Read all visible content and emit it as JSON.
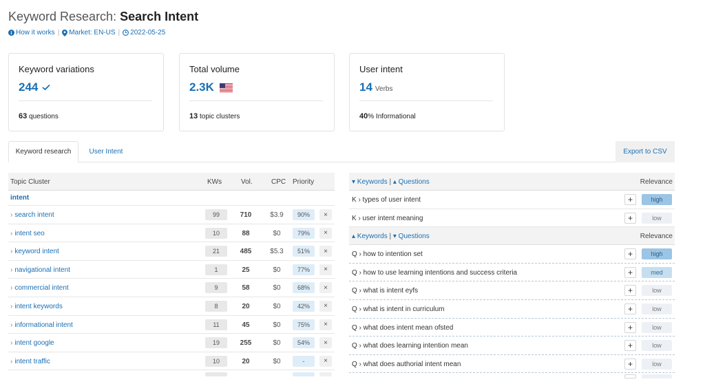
{
  "header": {
    "title_prefix": "Keyword Research: ",
    "title_strong": "Search Intent",
    "how_it_works": "How it works",
    "market": "Market: EN-US",
    "date": "2022-05-25"
  },
  "cards": [
    {
      "title": "Keyword variations",
      "main": "244",
      "unit": "",
      "icon": "check-icon",
      "foot_num": "63",
      "foot_text": " questions"
    },
    {
      "title": "Total volume",
      "main": "2.3K",
      "unit": "",
      "icon": "us-flag-icon",
      "foot_num": "13",
      "foot_text": " topic clusters"
    },
    {
      "title": "User intent",
      "main": "14",
      "unit": "Verbs",
      "icon": "",
      "foot_num": "40",
      "foot_text": "% Informational"
    }
  ],
  "tabs": {
    "active": "Keyword research",
    "other": "User Intent",
    "export": "Export to CSV"
  },
  "left_table": {
    "headers": {
      "cluster": "Topic Cluster",
      "kws": "KWs",
      "vol": "Vol.",
      "cpc": "CPC",
      "priority": "Priority"
    },
    "group": "intent",
    "rows": [
      {
        "kw": "search intent",
        "kws": "99",
        "vol": "710",
        "cpc": "$3.9",
        "priority": "90%"
      },
      {
        "kw": "intent seo",
        "kws": "10",
        "vol": "88",
        "cpc": "$0",
        "priority": "79%"
      },
      {
        "kw": "keyword intent",
        "kws": "21",
        "vol": "485",
        "cpc": "$5.3",
        "priority": "51%"
      },
      {
        "kw": "navigational intent",
        "kws": "1",
        "vol": "25",
        "cpc": "$0",
        "priority": "77%"
      },
      {
        "kw": "commercial intent",
        "kws": "9",
        "vol": "58",
        "cpc": "$0",
        "priority": "68%"
      },
      {
        "kw": "intent keywords",
        "kws": "8",
        "vol": "20",
        "cpc": "$0",
        "priority": "42%"
      },
      {
        "kw": "informational intent",
        "kws": "11",
        "vol": "45",
        "cpc": "$0",
        "priority": "75%"
      },
      {
        "kw": "intent google",
        "kws": "19",
        "vol": "255",
        "cpc": "$0",
        "priority": "54%"
      },
      {
        "kw": "intent traffic",
        "kws": "10",
        "vol": "20",
        "cpc": "$0",
        "priority": "-"
      }
    ],
    "remove_glyph": "×"
  },
  "right_table": {
    "section1": {
      "keywords_label": "▾ Keywords",
      "sep": " | ",
      "questions_label": "▴ Questions",
      "relevance": "Relevance"
    },
    "section1_rows": [
      {
        "text": "K › types of user intent",
        "relevance": "high"
      },
      {
        "text": "K › user intent meaning",
        "relevance": "low"
      }
    ],
    "section2": {
      "keywords_label": "▴ Keywords",
      "sep": " | ",
      "questions_label": "▾ Questions",
      "relevance": "Relevance"
    },
    "section2_rows": [
      {
        "text": "Q › how to intention set",
        "relevance": "high"
      },
      {
        "text": "Q › how to use learning intentions and success criteria",
        "relevance": "med"
      },
      {
        "text": "Q › what is intent eyfs",
        "relevance": "low"
      },
      {
        "text": "Q › what is intent in curriculum",
        "relevance": "low"
      },
      {
        "text": "Q › what does intent mean ofsted",
        "relevance": "low"
      },
      {
        "text": "Q › what does learning intention mean",
        "relevance": "low"
      },
      {
        "text": "Q › what does authorial intent mean",
        "relevance": "low"
      }
    ],
    "plus_glyph": "+"
  }
}
